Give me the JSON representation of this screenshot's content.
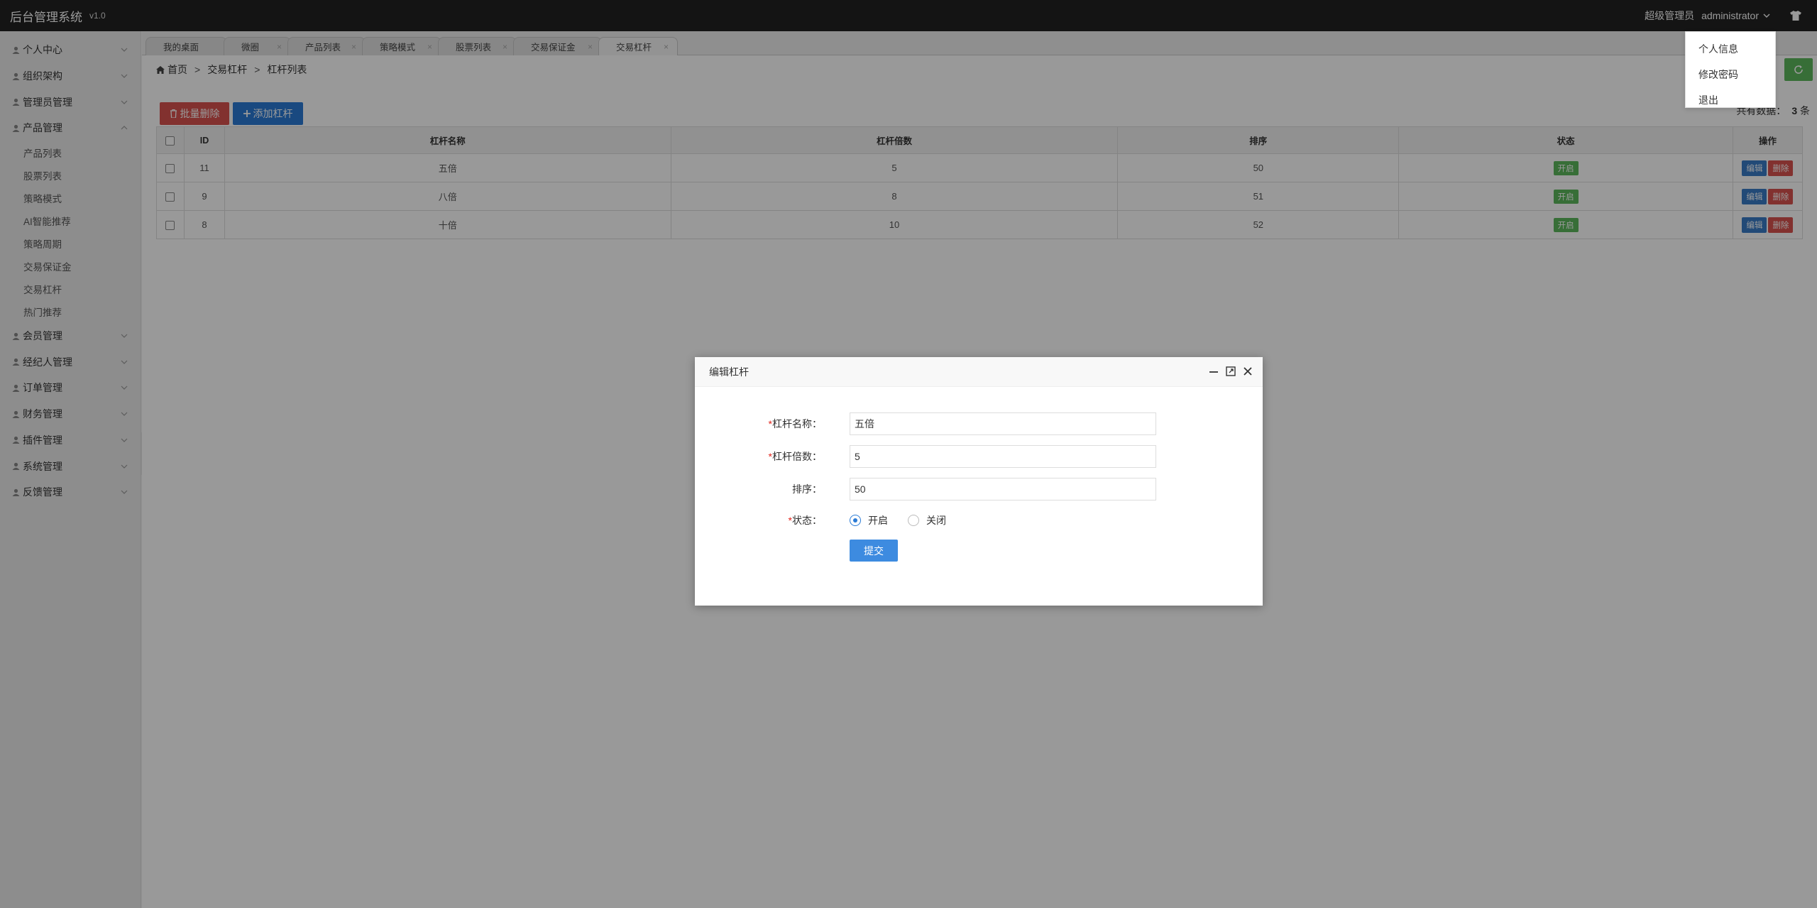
{
  "app": {
    "title": "后台管理系统",
    "version": "v1.0"
  },
  "header": {
    "role": "超级管理员",
    "username": "administrator"
  },
  "user_menu": [
    "个人信息",
    "修改密码",
    "退出"
  ],
  "sidebar": {
    "groups": [
      {
        "label": "个人中心",
        "icon": "user-icon"
      },
      {
        "label": "组织架构",
        "icon": "org-icon"
      },
      {
        "label": "管理员管理",
        "icon": "admin-icon"
      },
      {
        "label": "产品管理",
        "icon": "box-icon",
        "expanded": true,
        "items": [
          "产品列表",
          "股票列表",
          "策略模式",
          "AI智能推荐",
          "策略周期",
          "交易保证金",
          "交易杠杆",
          "热门推荐"
        ]
      },
      {
        "label": "会员管理",
        "icon": "user-icon"
      },
      {
        "label": "经纪人管理",
        "icon": "people-icon"
      },
      {
        "label": "订单管理",
        "icon": "order-icon"
      },
      {
        "label": "财务管理",
        "icon": "finance-icon"
      },
      {
        "label": "插件管理",
        "icon": "plugin-icon"
      },
      {
        "label": "系统管理",
        "icon": "gear-icon"
      },
      {
        "label": "反馈管理",
        "icon": "feedback-icon"
      }
    ]
  },
  "tabs": [
    {
      "label": "我的桌面"
    },
    {
      "label": "微圈"
    },
    {
      "label": "产品列表"
    },
    {
      "label": "策略模式"
    },
    {
      "label": "股票列表"
    },
    {
      "label": "交易保证金"
    },
    {
      "label": "交易杠杆",
      "active": true
    }
  ],
  "breadcrumb": {
    "home": "首页",
    "section": "交易杠杆",
    "page": "杠杆列表",
    "separator": ">"
  },
  "toolbar": {
    "batch_delete": "批量删除",
    "add": "添加杠杆"
  },
  "total": {
    "prefix": "共有数据：",
    "count": "3",
    "suffix": "条"
  },
  "table": {
    "columns": [
      "ID",
      "杠杆名称",
      "杠杆倍数",
      "排序",
      "状态",
      "操作"
    ],
    "rows": [
      {
        "id": "11",
        "name": "五倍",
        "multiple": "5",
        "sort": "50",
        "status": "开启"
      },
      {
        "id": "9",
        "name": "八倍",
        "multiple": "8",
        "sort": "51",
        "status": "开启"
      },
      {
        "id": "8",
        "name": "十倍",
        "multiple": "10",
        "sort": "52",
        "status": "开启"
      }
    ],
    "edit_label": "编辑",
    "delete_label": "删除"
  },
  "modal": {
    "title": "编辑杠杆",
    "fields": {
      "name_label": "杠杆名称：",
      "name_value": "五倍",
      "multiple_label": "杠杆倍数：",
      "multiple_value": "5",
      "sort_label": "排序：",
      "sort_value": "50",
      "status_label": "状态："
    },
    "required_mark": "*",
    "status_options": [
      {
        "label": "开启",
        "checked": true
      },
      {
        "label": "关闭",
        "checked": false
      }
    ],
    "submit_label": "提交"
  },
  "colors": {
    "accent": "#2b7bd6",
    "danger": "#d9534f",
    "success": "#5cb85c",
    "topbar": "#222222"
  }
}
